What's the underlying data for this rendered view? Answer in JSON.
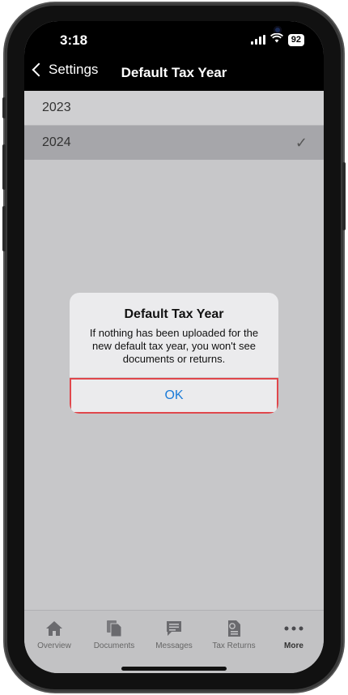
{
  "status_bar": {
    "time": "3:18",
    "battery": "92"
  },
  "nav": {
    "back_label": "Settings",
    "title": "Default Tax Year"
  },
  "year_options": [
    {
      "label": "2023",
      "selected": false
    },
    {
      "label": "2024",
      "selected": true
    }
  ],
  "checkmark": "✓",
  "alert": {
    "title": "Default Tax Year",
    "message": "If nothing has been uploaded for the new default tax year, you won't see documents or returns.",
    "ok_label": "OK"
  },
  "highlight_color": "#e0474c",
  "tabs": [
    {
      "label": "Overview",
      "icon": "home-icon"
    },
    {
      "label": "Documents",
      "icon": "documents-icon"
    },
    {
      "label": "Messages",
      "icon": "messages-icon"
    },
    {
      "label": "Tax Returns",
      "icon": "tax-returns-icon"
    },
    {
      "label": "More",
      "icon": "more-icon",
      "active": true
    }
  ]
}
